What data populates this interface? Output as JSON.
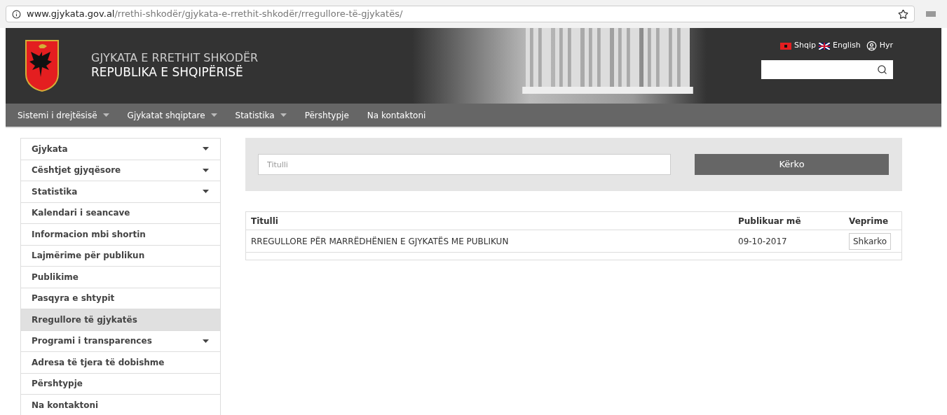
{
  "browser": {
    "url_host": "www.gjykata.gov.al",
    "url_path": "/rrethi-shkodër/gjykata-e-rrethit-shkodër/rregullore-të-gjykatës/"
  },
  "header": {
    "title": "GJYKATA E RRETHIT SHKODËR",
    "subtitle": "REPUBLIKA E SHQIPËRISË",
    "languages": [
      "Shqip",
      "English"
    ],
    "login": "Hyr"
  },
  "nav": [
    {
      "label": "Sistemi i drejtësisë",
      "has_dropdown": true
    },
    {
      "label": "Gjykatat shqiptare",
      "has_dropdown": true
    },
    {
      "label": "Statistika",
      "has_dropdown": true
    },
    {
      "label": "Përshtypje",
      "has_dropdown": false
    },
    {
      "label": "Na kontaktoni",
      "has_dropdown": false
    }
  ],
  "sidebar": {
    "items": [
      {
        "label": "Gjykata",
        "has_dropdown": true,
        "selected": false
      },
      {
        "label": "Cështjet gjyqësore",
        "has_dropdown": true,
        "selected": false
      },
      {
        "label": "Statistika",
        "has_dropdown": true,
        "selected": false
      },
      {
        "label": "Kalendari i seancave",
        "has_dropdown": false,
        "selected": false
      },
      {
        "label": "Informacion mbi shortin",
        "has_dropdown": false,
        "selected": false
      },
      {
        "label": "Lajmërime për publikun",
        "has_dropdown": false,
        "selected": false
      },
      {
        "label": "Publikime",
        "has_dropdown": false,
        "selected": false
      },
      {
        "label": "Pasqyra e shtypit",
        "has_dropdown": false,
        "selected": false
      },
      {
        "label": "Rregullore të gjykatës",
        "has_dropdown": false,
        "selected": true
      },
      {
        "label": "Programi i transparences",
        "has_dropdown": true,
        "selected": false
      },
      {
        "label": "Adresa të tjera të dobishme",
        "has_dropdown": false,
        "selected": false
      },
      {
        "label": "Përshtypje",
        "has_dropdown": false,
        "selected": false
      },
      {
        "label": "Na kontaktoni",
        "has_dropdown": false,
        "selected": false
      }
    ]
  },
  "search": {
    "placeholder": "Titulli",
    "button": "Kërko"
  },
  "table": {
    "columns": [
      "Titulli",
      "Publikuar më",
      "Veprime"
    ],
    "rows": [
      {
        "title": "RREGULLORE PËR MARRËDHËNIEN E GJYKATËS ME PUBLIKUN",
        "date": "09-10-2017",
        "action": "Shkarko"
      }
    ]
  }
}
